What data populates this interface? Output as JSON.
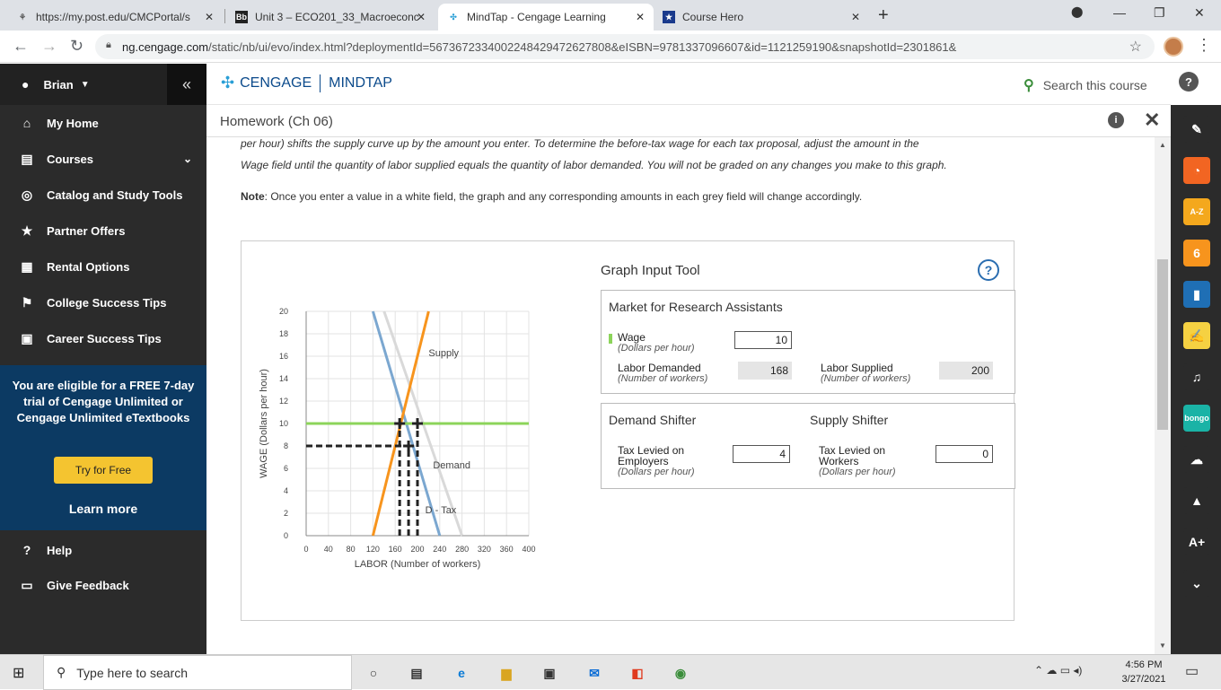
{
  "browser": {
    "tabs": [
      {
        "title": "https://my.post.edu/CMCPortal/s",
        "icon": "portal-icon"
      },
      {
        "title": "Unit 3 – ECO201_33_Macroeconc",
        "icon": "bb-icon"
      },
      {
        "title": "MindTap - Cengage Learning",
        "icon": "cengage-icon"
      },
      {
        "title": "Course Hero",
        "icon": "coursehero-icon"
      }
    ],
    "new_tab": "+",
    "url_host": "ng.cengage.com",
    "url_path": "/static/nb/ui/evo/index.html?deploymentId=5673672334002248429472627808&eISBN=9781337096607&id=1121259190&snapshotId=2301861&"
  },
  "sidebar": {
    "user": "Brian",
    "collapse": "«",
    "items": [
      {
        "label": "My Home",
        "icon": "home-icon",
        "glyph": "⌂"
      },
      {
        "label": "Courses",
        "icon": "book-icon",
        "glyph": "▤"
      },
      {
        "label": "Catalog and Study Tools",
        "icon": "compass-icon",
        "glyph": "◎"
      },
      {
        "label": "Partner Offers",
        "icon": "star-icon",
        "glyph": "★"
      },
      {
        "label": "Rental Options",
        "icon": "rental-icon",
        "glyph": "▦"
      },
      {
        "label": "College Success Tips",
        "icon": "graduation-cap-icon",
        "glyph": "⚑"
      },
      {
        "label": "Career Success Tips",
        "icon": "briefcase-icon",
        "glyph": "▣"
      }
    ],
    "promo_text": "You are eligible for a FREE 7-day trial of Cengage Unlimited or Cengage Unlimited eTextbooks",
    "promo_button": "Try for Free",
    "learn_more": "Learn more",
    "bottom_items": [
      {
        "label": "Help",
        "icon": "help-icon",
        "glyph": "?"
      },
      {
        "label": "Give Feedback",
        "icon": "feedback-icon",
        "glyph": "▭"
      }
    ]
  },
  "header": {
    "brand": "CENGAGE",
    "product": "MINDTAP",
    "search_placeholder": "Search this course"
  },
  "page": {
    "title": "Homework (Ch 06)",
    "instructions_1": "per hour) shifts the supply curve up by the amount you enter. To determine the before-tax wage for each tax proposal, adjust the amount in the",
    "instructions_2": "Wage field until the quantity of labor supplied equals the quantity of labor demanded. You will not be graded on any changes you make to this graph.",
    "note_label": "Note",
    "note_text": ": Once you enter a value in a white field, the graph and any corresponding amounts in each grey field will change accordingly."
  },
  "tool": {
    "title": "Graph Input Tool",
    "help": "?",
    "market_title": "Market for Research Assistants",
    "wage_label": "Wage",
    "wage_unit": "(Dollars per hour)",
    "wage_value": "10",
    "demanded_label": "Labor Demanded",
    "demanded_unit": "(Number of workers)",
    "demanded_value": "168",
    "supplied_label": "Labor Supplied",
    "supplied_unit": "(Number of workers)",
    "supplied_value": "200",
    "demand_shifter_title": "Demand Shifter",
    "supply_shifter_title": "Supply Shifter",
    "employer_tax_label": "Tax Levied on Employers",
    "employer_tax_unit": "(Dollars per hour)",
    "employer_tax_value": "4",
    "worker_tax_label": "Tax Levied on Workers",
    "worker_tax_unit": "(Dollars per hour)",
    "worker_tax_value": "0"
  },
  "chart_data": {
    "type": "line",
    "xlabel": "LABOR (Number of workers)",
    "ylabel": "WAGE (Dollars per hour)",
    "xlim": [
      0,
      400
    ],
    "ylim": [
      0,
      20
    ],
    "xticks": [
      0,
      40,
      80,
      120,
      160,
      200,
      240,
      280,
      320,
      360,
      400
    ],
    "yticks": [
      0,
      2,
      4,
      6,
      8,
      10,
      12,
      14,
      16,
      18,
      20
    ],
    "grid": true,
    "series": [
      {
        "name": "Supply",
        "color": "#f7941d",
        "x": [
          120,
          220
        ],
        "y": [
          0,
          20
        ]
      },
      {
        "name": "Demand",
        "color": "#d9d9d9",
        "x": [
          140,
          280
        ],
        "y": [
          20,
          0
        ]
      },
      {
        "name": "D - Tax",
        "color": "#7ba7d0",
        "x": [
          120,
          240
        ],
        "y": [
          20,
          0
        ]
      },
      {
        "name": "Wage",
        "color": "#8cd45a",
        "x": [
          0,
          400
        ],
        "y": [
          10,
          10
        ]
      }
    ],
    "markers": [
      {
        "x": 168,
        "y": 10
      },
      {
        "x": 200,
        "y": 10
      },
      {
        "x": 184,
        "y": 8
      }
    ],
    "dashed_guides": [
      {
        "x": [
          0,
          184
        ],
        "y": [
          8,
          8
        ]
      },
      {
        "x": [
          168,
          168
        ],
        "y": [
          0,
          10
        ]
      },
      {
        "x": [
          200,
          200
        ],
        "y": [
          0,
          10
        ]
      },
      {
        "x": [
          184,
          184
        ],
        "y": [
          0,
          8
        ]
      }
    ],
    "labels": [
      {
        "text": "Supply",
        "x": 220,
        "y": 16
      },
      {
        "text": "Demand",
        "x": 228,
        "y": 6
      },
      {
        "text": "D - Tax",
        "x": 214,
        "y": 2
      }
    ]
  },
  "rail": [
    {
      "icon": "pencil-icon",
      "color": "#2b2b2b",
      "glyph": "✎"
    },
    {
      "icon": "rss-icon",
      "color": "#f26522",
      "glyph": "◔"
    },
    {
      "icon": "dictionary-icon",
      "color": "#f4a81d",
      "glyph": "A-Z"
    },
    {
      "icon": "aplia-icon",
      "color": "#f7941d",
      "glyph": "6"
    },
    {
      "icon": "ebook-icon",
      "color": "#1f6fb5",
      "glyph": "▮"
    },
    {
      "icon": "notes-icon",
      "color": "#f5d142",
      "glyph": "✍"
    },
    {
      "icon": "readspeaker-icon",
      "color": "#2b2b2b",
      "glyph": "♫"
    },
    {
      "icon": "bongo-icon",
      "color": "#1ab3a6",
      "glyph": "bongo"
    },
    {
      "icon": "onedrive-icon",
      "color": "#2b2b2b",
      "glyph": "☁"
    },
    {
      "icon": "google-drive-icon",
      "color": "#2b2b2b",
      "glyph": "▲"
    },
    {
      "icon": "aplus-icon",
      "color": "#2b2b2b",
      "glyph": "A+"
    },
    {
      "icon": "more-icon",
      "color": "#2b2b2b",
      "glyph": "⌄"
    }
  ],
  "taskbar": {
    "search_placeholder": "Type here to search",
    "time": "4:56 PM",
    "date": "3/27/2021"
  }
}
